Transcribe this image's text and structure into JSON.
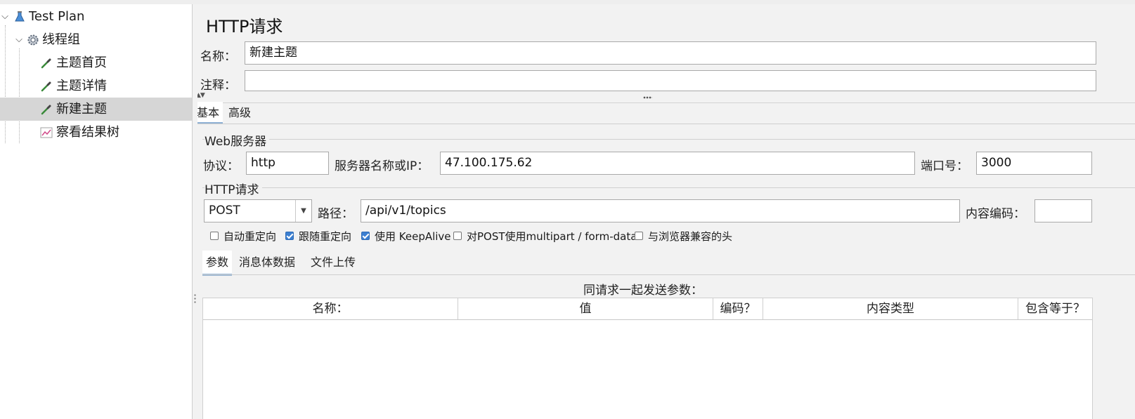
{
  "tree": {
    "items": [
      {
        "label": "Test Plan",
        "icon": "flask-icon"
      },
      {
        "label": "线程组",
        "icon": "gear-icon"
      },
      {
        "label": "主题首页",
        "icon": "pipette-icon"
      },
      {
        "label": "主题详情",
        "icon": "pipette-icon"
      },
      {
        "label": "新建主题",
        "icon": "pipette-icon"
      },
      {
        "label": "察看结果树",
        "icon": "chart-icon"
      }
    ]
  },
  "panel": {
    "title": "HTTP请求",
    "name_label": "名称：",
    "name_value": "新建主题",
    "comment_label": "注释：",
    "comment_value": ""
  },
  "tabs": {
    "basic": "基本",
    "advanced": "高级"
  },
  "web_server": {
    "group_title": "Web服务器",
    "protocol_label": "协议：",
    "protocol_value": "http",
    "server_label": "服务器名称或IP：",
    "server_value": "47.100.175.62",
    "port_label": "端口号：",
    "port_value": "3000"
  },
  "http_request": {
    "group_title": "HTTP请求",
    "method": "POST",
    "path_label": "路径：",
    "path_value": "/api/v1/topics",
    "encoding_label": "内容编码：",
    "encoding_value": ""
  },
  "options": [
    {
      "label": "自动重定向",
      "checked": false
    },
    {
      "label": "跟随重定向",
      "checked": true
    },
    {
      "label": "使用 KeepAlive",
      "checked": true
    },
    {
      "label": "对POST使用multipart / form-data",
      "checked": false
    },
    {
      "label": "与浏览器兼容的头",
      "checked": false
    }
  ],
  "sub_tabs": {
    "params": "参数",
    "body": "消息体数据",
    "files": "文件上传"
  },
  "params": {
    "caption": "同请求一起发送参数：",
    "columns": [
      "名称：",
      "值",
      "编码？",
      "内容类型",
      "包含等于？"
    ]
  },
  "colors": {
    "accent": "#3c7fd1",
    "selected_row": "#d6d6d6",
    "panel_bg": "#f2f2f2"
  }
}
